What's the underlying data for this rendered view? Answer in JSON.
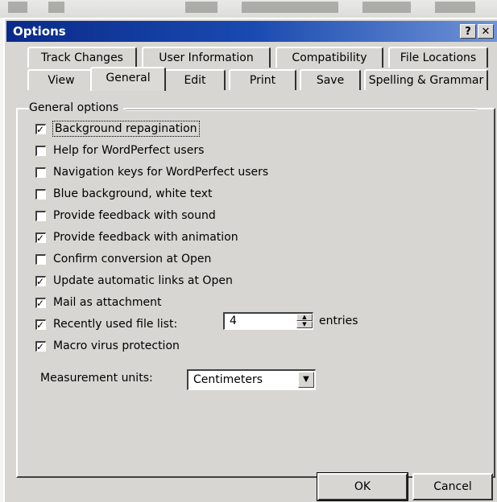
{
  "window": {
    "title": "Options",
    "help_button": "?",
    "close_button": "✕"
  },
  "tabs_back": [
    {
      "label": "Track Changes"
    },
    {
      "label": "User Information"
    },
    {
      "label": "Compatibility"
    },
    {
      "label": "File Locations"
    }
  ],
  "tabs_front": [
    {
      "label": "View"
    },
    {
      "label": "General",
      "active": true
    },
    {
      "label": "Edit"
    },
    {
      "label": "Print"
    },
    {
      "label": "Save"
    },
    {
      "label": "Spelling & Grammar"
    }
  ],
  "general_options": {
    "heading": "General options",
    "items": [
      {
        "label": "Background repagination",
        "checked": true
      },
      {
        "label": "Help for WordPerfect users",
        "checked": false
      },
      {
        "label": "Navigation keys for WordPerfect users",
        "checked": false
      },
      {
        "label": "Blue background, white text",
        "checked": false
      },
      {
        "label": "Provide feedback with sound",
        "checked": false
      },
      {
        "label": "Provide feedback with animation",
        "checked": true
      },
      {
        "label": "Confirm conversion at Open",
        "checked": false
      },
      {
        "label": "Update automatic links at Open",
        "checked": true
      },
      {
        "label": "Mail as attachment",
        "checked": true
      },
      {
        "label": "Recently used file list:",
        "checked": true
      },
      {
        "label": "Macro virus protection",
        "checked": true
      }
    ]
  },
  "recent_files": {
    "value": "4",
    "suffix": "entries"
  },
  "measurement": {
    "label": "Measurement units:",
    "value": "Centimeters"
  },
  "buttons": {
    "ok": "OK",
    "cancel": "Cancel"
  },
  "icons": {
    "checkbox_mark": "check-icon",
    "dropdown": "chevron-down-icon",
    "spin_up": "arrow-up-icon",
    "spin_down": "arrow-down-icon"
  }
}
